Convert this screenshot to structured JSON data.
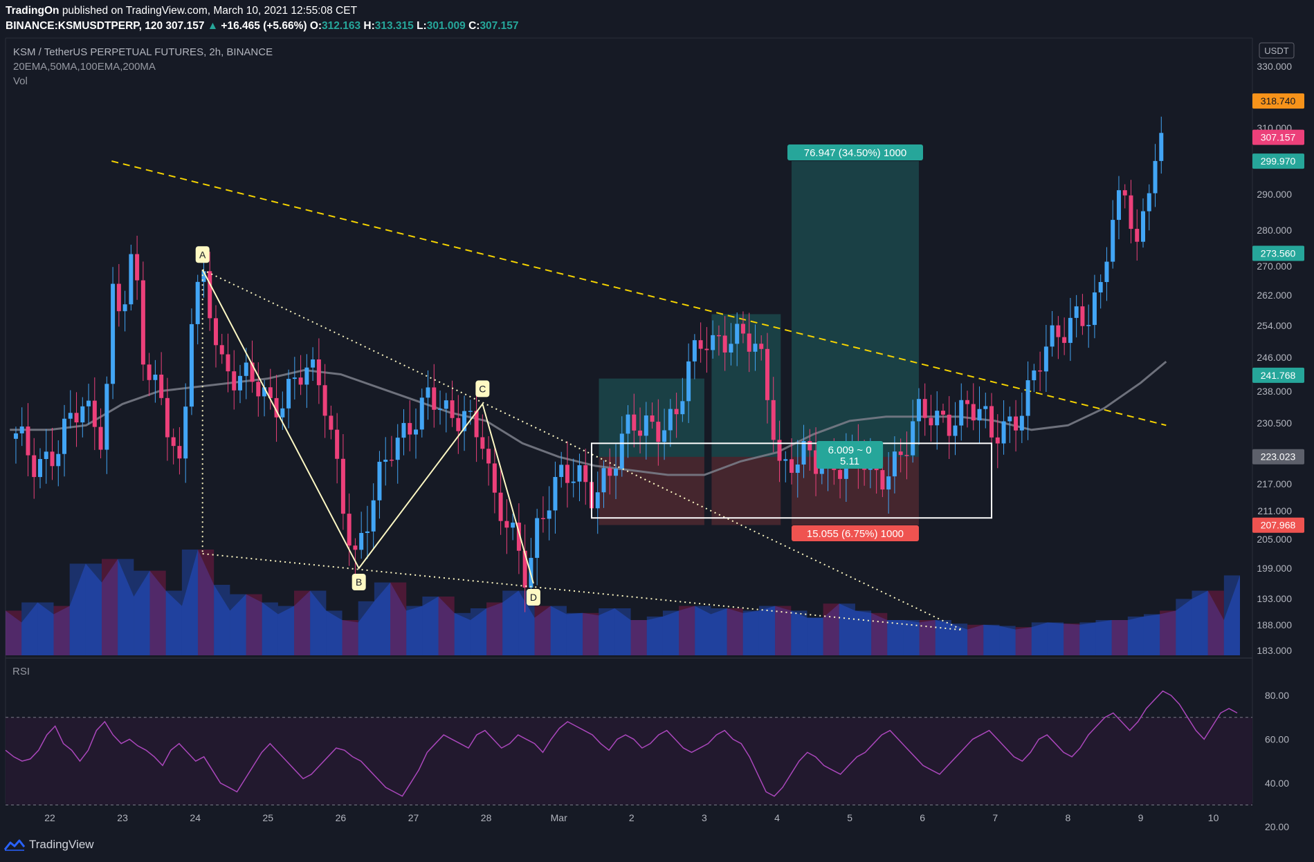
{
  "header": {
    "author": "TradingOn",
    "published": "published on TradingView.com, March 10, 2021 12:55:08 CET",
    "symbol": "BINANCE:KSMUSDTPERP, 120",
    "last": "307.157",
    "change": "+16.465 (+5.66%)",
    "o_label": "O:",
    "o": "312.163",
    "h_label": "H:",
    "h": "313.315",
    "l_label": "L:",
    "l": "301.009",
    "c_label": "C:",
    "c": "307.157"
  },
  "legend": {
    "symbol": "KSM / TetherUS PERPETUAL FUTURES, 2h, BINANCE",
    "indicators": "20EMA,50MA,100EMA,200MA",
    "volume": "Vol"
  },
  "rsi_label": "RSI",
  "footer": {
    "brand": "TradingView"
  },
  "colors": {
    "background": "#161a25",
    "up": "#42a5f5",
    "down": "#ec407a",
    "ma": "#787b86",
    "trendline": "#f5d300",
    "pattern": "#fff9c4",
    "rsi": "#ab47bc",
    "profit": "#26a69a",
    "loss": "#ef5350"
  },
  "chart_data": [
    {
      "type": "candlestick",
      "title": "KSM / TetherUS PERPETUAL FUTURES, 2h, BINANCE",
      "y_unit": "USDT",
      "ylim": [
        182.5,
        334
      ],
      "y_ticks": [
        "330.000",
        "310.000",
        "290.000",
        "280.000",
        "270.000",
        "262.000",
        "254.000",
        "246.000",
        "238.000",
        "230.500",
        "217.000",
        "211.000",
        "205.000",
        "199.000",
        "193.000",
        "188.000",
        "183.000"
      ],
      "x_ticks": [
        "22",
        "23",
        "24",
        "25",
        "26",
        "27",
        "28",
        "Mar",
        "2",
        "3",
        "4",
        "5",
        "6",
        "7",
        "8",
        "9",
        "10"
      ],
      "price_path": [
        [
          21.45,
          227
        ],
        [
          21.8,
          222
        ],
        [
          22.1,
          226
        ],
        [
          22.45,
          233
        ],
        [
          22.75,
          229
        ],
        [
          22.85,
          265
        ],
        [
          23.0,
          258
        ],
        [
          23.15,
          272
        ],
        [
          23.3,
          242
        ],
        [
          23.55,
          238
        ],
        [
          23.8,
          219
        ],
        [
          23.95,
          255
        ],
        [
          24.1,
          266
        ],
        [
          24.35,
          246
        ],
        [
          24.75,
          240
        ],
        [
          25.05,
          233
        ],
        [
          25.3,
          241
        ],
        [
          25.5,
          244
        ],
        [
          25.75,
          236
        ],
        [
          26.0,
          217
        ],
        [
          26.2,
          202
        ],
        [
          26.45,
          212
        ],
        [
          26.7,
          225
        ],
        [
          26.95,
          232
        ],
        [
          27.2,
          236
        ],
        [
          27.5,
          230
        ],
        [
          27.7,
          235
        ],
        [
          27.95,
          228
        ],
        [
          28.1,
          211
        ],
        [
          28.3,
          207
        ],
        [
          28.55,
          200
        ],
        [
          28.7,
          208
        ],
        [
          28.9,
          214
        ],
        [
          29.25,
          220
        ],
        [
          29.45,
          217
        ],
        [
          29.7,
          218
        ],
        [
          29.85,
          224
        ],
        [
          30.0,
          230
        ],
        [
          30.2,
          232
        ],
        [
          30.35,
          231
        ],
        [
          30.6,
          229
        ],
        [
          30.8,
          244
        ],
        [
          31.0,
          253
        ],
        [
          31.3,
          250
        ],
        [
          31.5,
          249
        ],
        [
          31.75,
          249
        ],
        [
          31.95,
          232
        ],
        [
          32.05,
          220
        ],
        [
          32.3,
          221
        ],
        [
          32.5,
          222
        ],
        [
          32.8,
          223
        ],
        [
          33.05,
          222
        ],
        [
          33.35,
          218
        ],
        [
          33.6,
          223
        ],
        [
          33.8,
          227
        ],
        [
          33.95,
          231
        ],
        [
          34.2,
          231
        ],
        [
          34.4,
          233
        ],
        [
          34.6,
          235
        ],
        [
          34.75,
          232
        ],
        [
          34.95,
          227
        ],
        [
          35.15,
          231
        ],
        [
          35.4,
          236
        ],
        [
          35.6,
          243
        ],
        [
          35.8,
          250
        ],
        [
          35.95,
          254
        ],
        [
          36.1,
          259
        ],
        [
          36.3,
          256
        ],
        [
          36.45,
          262
        ],
        [
          36.65,
          286
        ],
        [
          36.8,
          292
        ],
        [
          36.95,
          278
        ],
        [
          37.05,
          285
        ],
        [
          37.2,
          301
        ],
        [
          37.35,
          306
        ]
      ],
      "last_price": 307.157,
      "level_labels": [
        {
          "text": "318.740",
          "color": "#f7931a",
          "value": 318.74
        },
        {
          "text": "307.157",
          "color": "#ec407a",
          "value": 307.157
        },
        {
          "text": "299.970",
          "color": "#26a69a",
          "value": 299.97
        },
        {
          "text": "273.560",
          "color": "#26a69a",
          "value": 273.56
        },
        {
          "text": "241.768",
          "color": "#26a69a",
          "value": 241.768
        },
        {
          "text": "223.023",
          "color": "#5d606b",
          "value": 223.023
        },
        {
          "text": "207.968",
          "color": "#ef5350",
          "value": 207.968
        }
      ],
      "moving_average": [
        [
          21.45,
          229
        ],
        [
          22.0,
          229
        ],
        [
          22.5,
          230
        ],
        [
          23.0,
          235
        ],
        [
          23.5,
          238
        ],
        [
          24.0,
          239
        ],
        [
          24.5,
          240
        ],
        [
          25.0,
          241
        ],
        [
          25.5,
          243
        ],
        [
          26.0,
          242
        ],
        [
          26.5,
          239
        ],
        [
          27.0,
          236
        ],
        [
          27.5,
          233
        ],
        [
          28.0,
          231
        ],
        [
          28.5,
          226
        ],
        [
          29.0,
          223
        ],
        [
          29.5,
          221
        ],
        [
          30.0,
          220
        ],
        [
          30.5,
          219
        ],
        [
          31.0,
          219
        ],
        [
          31.5,
          222
        ],
        [
          32.0,
          224
        ],
        [
          32.5,
          228
        ],
        [
          33.0,
          231
        ],
        [
          33.5,
          232
        ],
        [
          34.0,
          232
        ],
        [
          34.5,
          232
        ],
        [
          35.0,
          231
        ],
        [
          35.5,
          229
        ],
        [
          36.0,
          230
        ],
        [
          36.5,
          234
        ],
        [
          37.0,
          240
        ],
        [
          37.35,
          245
        ]
      ],
      "trendline": {
        "from": [
          22.85,
          300
        ],
        "to": [
          37.35,
          230
        ]
      },
      "pattern": {
        "points": [
          {
            "label": "A",
            "x": 24.1,
            "y": 269
          },
          {
            "label": "B",
            "x": 26.25,
            "y": 199
          },
          {
            "label": "C",
            "x": 27.95,
            "y": 235
          },
          {
            "label": "D",
            "x": 28.65,
            "y": 196
          }
        ],
        "base_from": [
          24.1,
          202
        ],
        "base_to": [
          34.55,
          187
        ]
      },
      "positions": [
        {
          "x0": 29.55,
          "x1": 31.0,
          "entry": 223,
          "target": 241,
          "stop": 208
        },
        {
          "x0": 31.1,
          "x1": 32.05,
          "entry": 223,
          "target": 257,
          "stop": 208
        },
        {
          "x0": 32.2,
          "x1": 33.95,
          "entry": 223,
          "target": 300,
          "stop": 208,
          "target_label": "76.947 (34.50%) 1000",
          "stop_label": "15.055 (6.75%) 1000"
        }
      ],
      "measure_box": {
        "x0": 29.45,
        "x1": 34.95,
        "y0": 209.5,
        "y1": 226
      },
      "measure_label": [
        "6.009 ~ 0",
        "5.11"
      ]
    },
    {
      "type": "area",
      "title": "Vol",
      "values": [
        0.38,
        0.28,
        0.45,
        0.35,
        0.42,
        0.78,
        0.62,
        0.82,
        0.5,
        0.72,
        0.55,
        0.42,
        0.9,
        0.6,
        0.38,
        0.52,
        0.45,
        0.35,
        0.42,
        0.55,
        0.38,
        0.3,
        0.28,
        0.46,
        0.62,
        0.38,
        0.42,
        0.5,
        0.36,
        0.3,
        0.4,
        0.45,
        0.55,
        0.32,
        0.42,
        0.35,
        0.36,
        0.34,
        0.4,
        0.3,
        0.3,
        0.33,
        0.38,
        0.42,
        0.35,
        0.4,
        0.36,
        0.38,
        0.42,
        0.38,
        0.32,
        0.32,
        0.44,
        0.38,
        0.36,
        0.3,
        0.3,
        0.28,
        0.3,
        0.27,
        0.22,
        0.26,
        0.25,
        0.22,
        0.24,
        0.28,
        0.27,
        0.26,
        0.28,
        0.3,
        0.3,
        0.33,
        0.35,
        0.38,
        0.48,
        0.55,
        0.3,
        0.68
      ]
    },
    {
      "type": "line",
      "title": "RSI",
      "ylim": [
        20,
        82
      ],
      "y_ticks": [
        "80.00",
        "60.00",
        "40.00",
        "20.00"
      ],
      "bands": [
        70,
        30
      ],
      "values": [
        55,
        52,
        50,
        51,
        55,
        62,
        66,
        58,
        55,
        50,
        55,
        64,
        68,
        62,
        58,
        60,
        57,
        55,
        52,
        48,
        55,
        58,
        54,
        50,
        52,
        46,
        40,
        38,
        36,
        42,
        48,
        54,
        58,
        54,
        50,
        46,
        42,
        44,
        48,
        52,
        56,
        55,
        52,
        50,
        46,
        42,
        38,
        36,
        34,
        40,
        46,
        54,
        58,
        62,
        60,
        58,
        56,
        62,
        64,
        60,
        56,
        58,
        62,
        60,
        58,
        54,
        60,
        65,
        68,
        66,
        64,
        62,
        58,
        55,
        60,
        62,
        60,
        56,
        58,
        62,
        64,
        60,
        56,
        54,
        56,
        58,
        62,
        64,
        60,
        58,
        52,
        44,
        36,
        34,
        38,
        44,
        50,
        54,
        52,
        48,
        46,
        44,
        48,
        52,
        54,
        58,
        62,
        64,
        60,
        56,
        52,
        48,
        46,
        44,
        48,
        52,
        56,
        60,
        62,
        64,
        60,
        56,
        52,
        50,
        54,
        60,
        62,
        58,
        54,
        52,
        56,
        62,
        66,
        70,
        72,
        68,
        64,
        68,
        74,
        78,
        82,
        80,
        76,
        70,
        64,
        60,
        66,
        72,
        74,
        72
      ]
    }
  ]
}
